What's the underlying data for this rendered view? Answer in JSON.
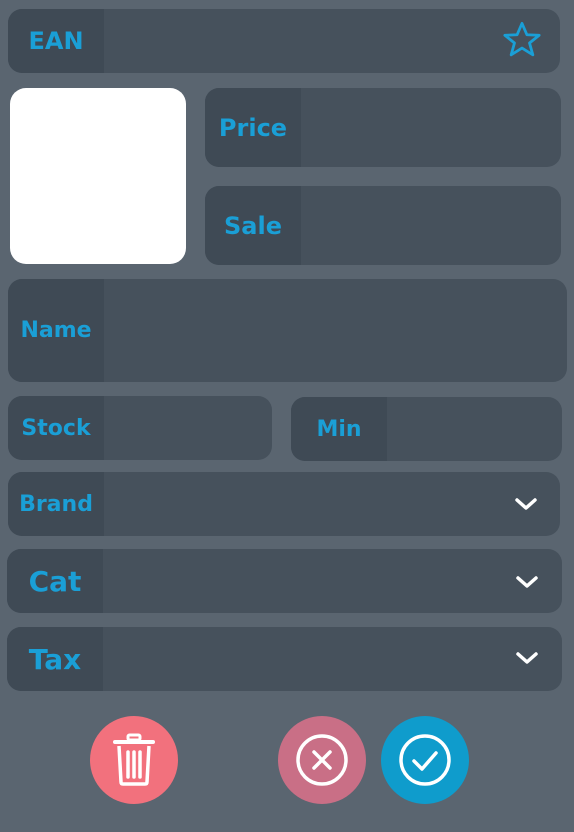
{
  "fields": {
    "ean": {
      "label": "EAN",
      "value": ""
    },
    "price": {
      "label": "Price",
      "value": ""
    },
    "sale": {
      "label": "Sale",
      "value": ""
    },
    "name": {
      "label": "Name",
      "value": ""
    },
    "stock": {
      "label": "Stock",
      "value": ""
    },
    "min": {
      "label": "Min",
      "value": ""
    },
    "brand": {
      "label": "Brand",
      "value": ""
    },
    "cat": {
      "label": "Cat",
      "value": ""
    },
    "tax": {
      "label": "Tax",
      "value": ""
    }
  },
  "icons": {
    "favorite": "star-icon",
    "dropdown": "chevron-down-icon",
    "delete": "trash-icon",
    "cancel": "close-circle-icon",
    "confirm": "check-circle-icon"
  },
  "colors": {
    "accent": "#1a9fd6",
    "delete": "#f2717d",
    "cancel": "#c96f86",
    "confirm": "#0f9ccc",
    "background": "#5a6570",
    "field": "#46515c",
    "label_bg": "#3f4a55"
  }
}
